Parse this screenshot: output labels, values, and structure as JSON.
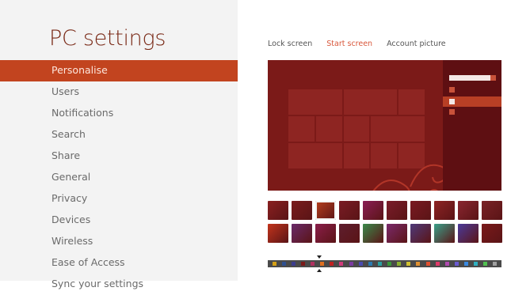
{
  "sidebar": {
    "title": "PC settings",
    "items": [
      {
        "label": "Personalise",
        "active": true
      },
      {
        "label": "Users"
      },
      {
        "label": "Notifications"
      },
      {
        "label": "Search"
      },
      {
        "label": "Share"
      },
      {
        "label": "General"
      },
      {
        "label": "Privacy"
      },
      {
        "label": "Devices"
      },
      {
        "label": "Wireless"
      },
      {
        "label": "Ease of Access"
      },
      {
        "label": "Sync your settings"
      }
    ]
  },
  "tabs": [
    {
      "label": "Lock screen"
    },
    {
      "label": "Start screen",
      "active": true
    },
    {
      "label": "Account picture"
    }
  ],
  "colors": {
    "accent": "#c2441f",
    "preview_background": "#7b1a18",
    "tile": "#8e2522",
    "charms": "#5e0f12"
  },
  "pattern_thumbnails": [
    {
      "color": "#8a2020"
    },
    {
      "color": "#7a1c1c"
    },
    {
      "color": "#b8401e",
      "selected": true
    },
    {
      "color": "#7a1c25"
    },
    {
      "color": "#8a1e55"
    },
    {
      "color": "#7a1c2a"
    },
    {
      "color": "#7a1a22"
    },
    {
      "color": "#8e2424"
    },
    {
      "color": "#8a2630"
    },
    {
      "color": "#7a2226"
    },
    {
      "color": "#c2341c"
    },
    {
      "color": "#6a2a6a"
    },
    {
      "color": "#8a1e4a"
    },
    {
      "color": "#5e1e2e"
    },
    {
      "color": "#3a8a4a"
    },
    {
      "color": "#7a2a6a"
    },
    {
      "color": "#4e3a7a"
    },
    {
      "color": "#3aa08a"
    },
    {
      "color": "#4a3a9a"
    },
    {
      "color": "#7a1a1a"
    }
  ],
  "color_swatches": [
    {
      "color": "#d4a017"
    },
    {
      "color": "#2f4f8f"
    },
    {
      "color": "#3c3c8c"
    },
    {
      "color": "#7a1a1a"
    },
    {
      "color": "#b03060"
    },
    {
      "color": "#e07020"
    },
    {
      "color": "#c02020"
    },
    {
      "color": "#d03a7a"
    },
    {
      "color": "#7a3aa0"
    },
    {
      "color": "#4a4ab0"
    },
    {
      "color": "#2a7ab0"
    },
    {
      "color": "#2aa0a0"
    },
    {
      "color": "#3a9a3a"
    },
    {
      "color": "#8ab030"
    },
    {
      "color": "#d0c030"
    },
    {
      "color": "#e09030"
    },
    {
      "color": "#e05030"
    },
    {
      "color": "#e03a6a"
    },
    {
      "color": "#b04ab0"
    },
    {
      "color": "#6a5ad0"
    },
    {
      "color": "#3a8ae0"
    },
    {
      "color": "#30b0c0"
    },
    {
      "color": "#50c050"
    },
    {
      "color": "#a0a0a0"
    }
  ]
}
